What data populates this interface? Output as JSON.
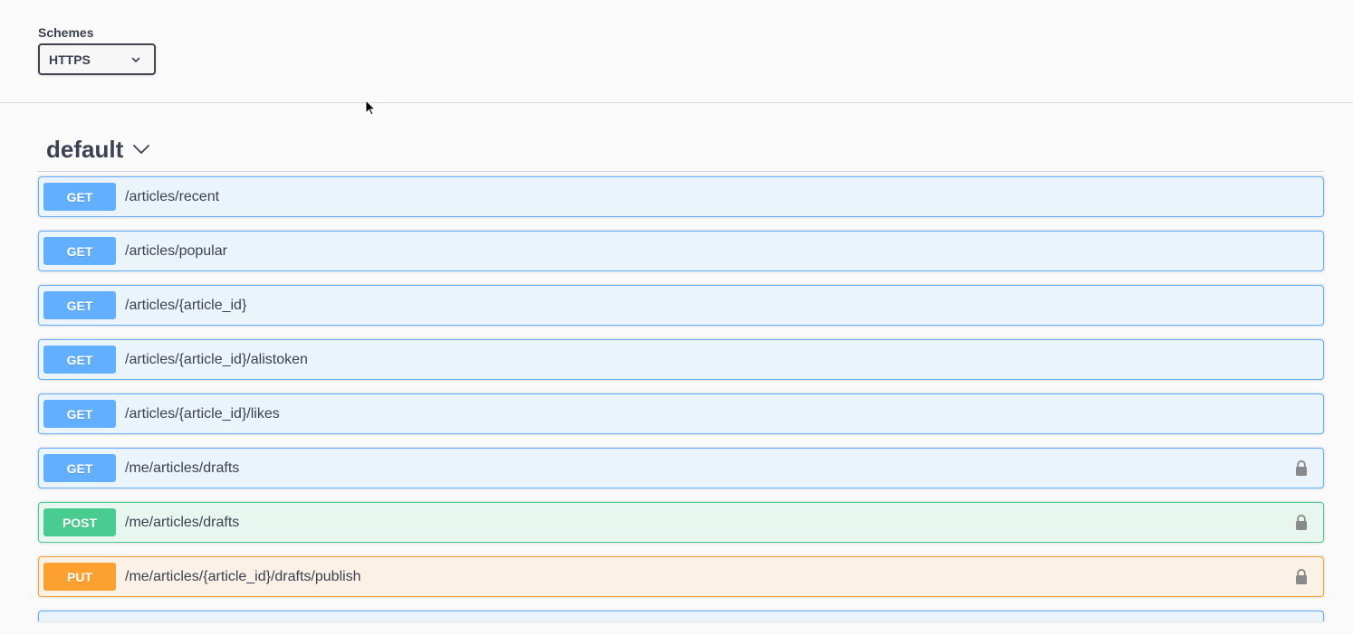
{
  "schemes": {
    "label": "Schemes",
    "selected": "HTTPS",
    "options": [
      "HTTPS"
    ]
  },
  "tag": {
    "title": "default"
  },
  "operations": [
    {
      "method": "GET",
      "path": "/articles/recent",
      "locked": false
    },
    {
      "method": "GET",
      "path": "/articles/popular",
      "locked": false
    },
    {
      "method": "GET",
      "path": "/articles/{article_id}",
      "locked": false
    },
    {
      "method": "GET",
      "path": "/articles/{article_id}/alistoken",
      "locked": false
    },
    {
      "method": "GET",
      "path": "/articles/{article_id}/likes",
      "locked": false
    },
    {
      "method": "GET",
      "path": "/me/articles/drafts",
      "locked": true
    },
    {
      "method": "POST",
      "path": "/me/articles/drafts",
      "locked": true
    },
    {
      "method": "PUT",
      "path": "/me/articles/{article_id}/drafts/publish",
      "locked": true
    }
  ],
  "colors": {
    "get": "#61affe",
    "post": "#49cc90",
    "put": "#fca130",
    "text": "#3b4151"
  },
  "icons": {
    "select": "chevron-down-icon",
    "tag": "chevron-down-icon",
    "auth": "lock-icon",
    "pointer": "cursor-icon"
  }
}
